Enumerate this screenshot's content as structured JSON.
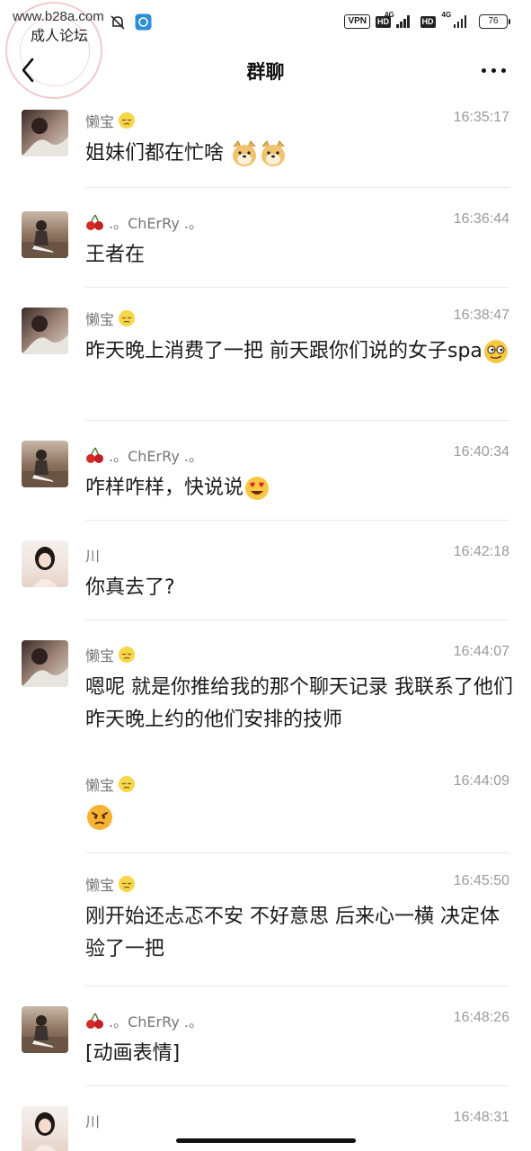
{
  "status": {
    "watermark_url": "www.b28a.com",
    "watermark_title": "成人论坛",
    "vpn": "VPN",
    "hd": "HD",
    "net": "4G",
    "battery": "76"
  },
  "header": {
    "title": "群聊"
  },
  "messages": [
    {
      "sender": "懒宝",
      "time": "16:35:17",
      "text": "姐妹们都在忙啥"
    },
    {
      "sender": ".。ChErRy .。",
      "time": "16:36:44",
      "text": "王者在"
    },
    {
      "sender": "懒宝",
      "time": "16:38:47",
      "text": "昨天晚上消费了一把 前天跟你们说的女子spa"
    },
    {
      "sender": ".。ChErRy .。",
      "time": "16:40:34",
      "text": "咋样咋样，快说说"
    },
    {
      "sender": "川",
      "time": "16:42:18",
      "text": "你真去了?"
    },
    {
      "sender": "懒宝",
      "time": "16:44:07",
      "text": "嗯呢 就是你推给我的那个聊天记录 我联系了他们 昨天晚上约的他们安排的技师"
    },
    {
      "sender": "懒宝",
      "time": "16:44:09",
      "text": ""
    },
    {
      "sender": "懒宝",
      "time": "16:45:50",
      "text": "刚开始还忐忑不安 不好意思 后来心一横 决定体验了一把"
    },
    {
      "sender": ".。ChErRy .。",
      "time": "16:48:26",
      "text": "[动画表情]"
    },
    {
      "sender": "川",
      "time": "16:48:31",
      "text": ""
    }
  ],
  "icons": {
    "back": "chevron-left-icon",
    "more": "more-dots-icon",
    "sender_badge": "sleepy-face-icon",
    "cherry": "cherry-icon"
  }
}
